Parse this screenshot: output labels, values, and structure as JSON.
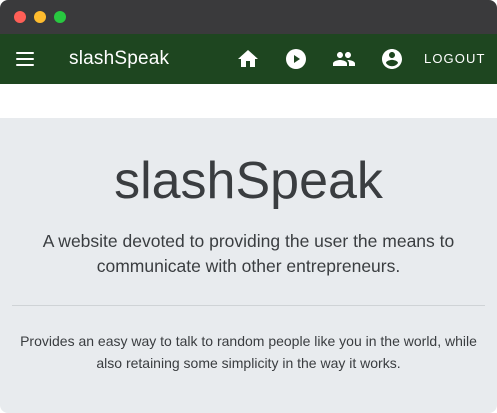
{
  "window": {
    "controls": [
      "close",
      "minimize",
      "zoom"
    ]
  },
  "navbar": {
    "menu_icon": "hamburger-menu-icon",
    "brand": "slashSpeak",
    "icons": [
      "home-icon",
      "play-circle-icon",
      "people-icon",
      "account-circle-icon"
    ],
    "logout_label": "LOGOUT",
    "background": "#1e4620"
  },
  "hero": {
    "title": "slashSpeak",
    "lead": "A website devoted to providing the user the means to communicate with other entrepreneurs.",
    "description": "Provides an easy way to talk to random people like you in the world, while also retaining some simplicity in the way it works."
  }
}
